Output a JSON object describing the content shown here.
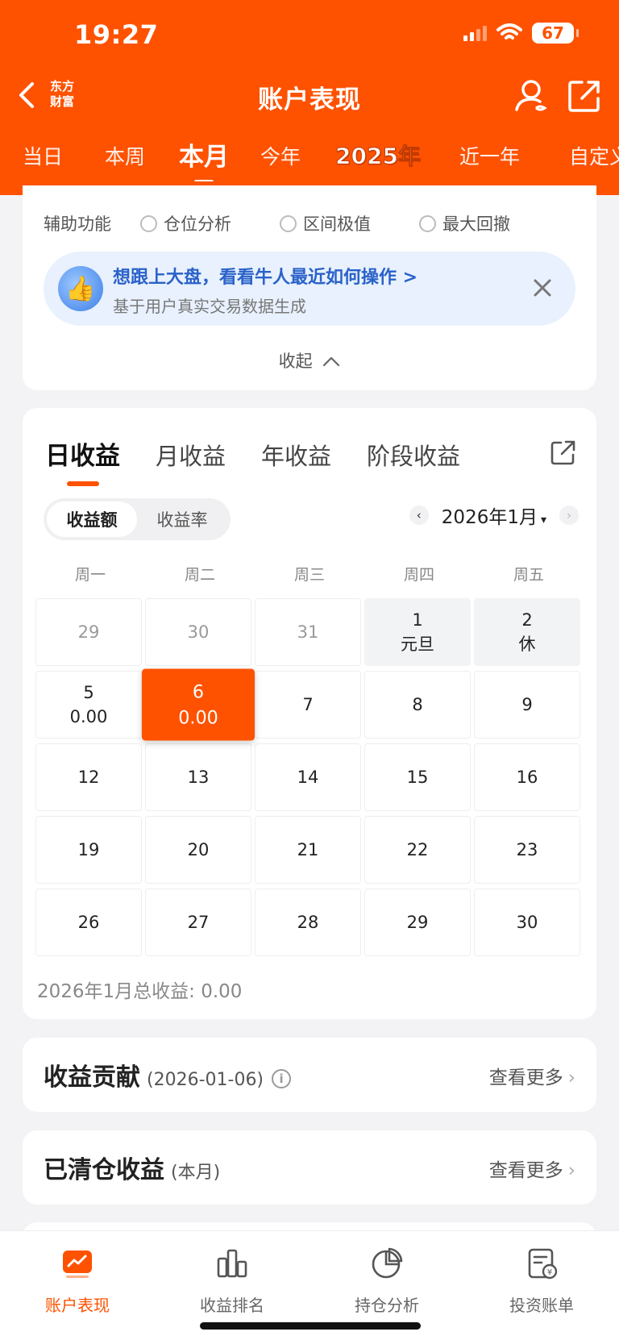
{
  "status_bar": {
    "time": "19:27",
    "battery": "67"
  },
  "header": {
    "brand_line1": "东方",
    "brand_line2": "财富",
    "title": "账户表现",
    "period_tabs": [
      "当日",
      "本周",
      "本月",
      "今年",
      "2025年",
      "近一年",
      "自定义"
    ],
    "active_period": "本月",
    "accent_color": "#fe5200"
  },
  "aux": {
    "label": "辅助功能",
    "options": [
      "仓位分析",
      "区间极值",
      "最大回撤"
    ]
  },
  "banner": {
    "title": "想跟上大盘，看看牛人最近如何操作 >",
    "subtitle": "基于用户真实交易数据生成"
  },
  "collapse_label": "收起",
  "earnings": {
    "tabs": [
      "日收益",
      "月收益",
      "年收益",
      "阶段收益"
    ],
    "active_tab": "日收益",
    "segment": [
      "收益额",
      "收益率"
    ],
    "active_segment": "收益额",
    "month": "2026年1月",
    "weekdays": [
      "周一",
      "周二",
      "周三",
      "周四",
      "周五"
    ],
    "cells": [
      {
        "day": "29",
        "sub": ""
      },
      {
        "day": "30",
        "sub": ""
      },
      {
        "day": "31",
        "sub": ""
      },
      {
        "day": "1",
        "sub": "元旦"
      },
      {
        "day": "2",
        "sub": "休"
      },
      {
        "day": "5",
        "sub": "0.00"
      },
      {
        "day": "6",
        "sub": "0.00"
      },
      {
        "day": "7",
        "sub": ""
      },
      {
        "day": "8",
        "sub": ""
      },
      {
        "day": "9",
        "sub": ""
      },
      {
        "day": "12",
        "sub": ""
      },
      {
        "day": "13",
        "sub": ""
      },
      {
        "day": "14",
        "sub": ""
      },
      {
        "day": "15",
        "sub": ""
      },
      {
        "day": "16",
        "sub": ""
      },
      {
        "day": "19",
        "sub": ""
      },
      {
        "day": "20",
        "sub": ""
      },
      {
        "day": "21",
        "sub": ""
      },
      {
        "day": "22",
        "sub": ""
      },
      {
        "day": "23",
        "sub": ""
      },
      {
        "day": "26",
        "sub": ""
      },
      {
        "day": "27",
        "sub": ""
      },
      {
        "day": "28",
        "sub": ""
      },
      {
        "day": "29",
        "sub": ""
      },
      {
        "day": "30",
        "sub": ""
      }
    ],
    "total": "2026年1月总收益: 0.00"
  },
  "contribution": {
    "title": "收益贡献",
    "subtitle": "(2026-01-06)",
    "more": "查看更多"
  },
  "cleared": {
    "title": "已清仓收益",
    "subtitle": "(本月)",
    "more": "查看更多"
  },
  "bottom_nav": [
    "账户表现",
    "收益排名",
    "持仓分析",
    "投资账单"
  ]
}
